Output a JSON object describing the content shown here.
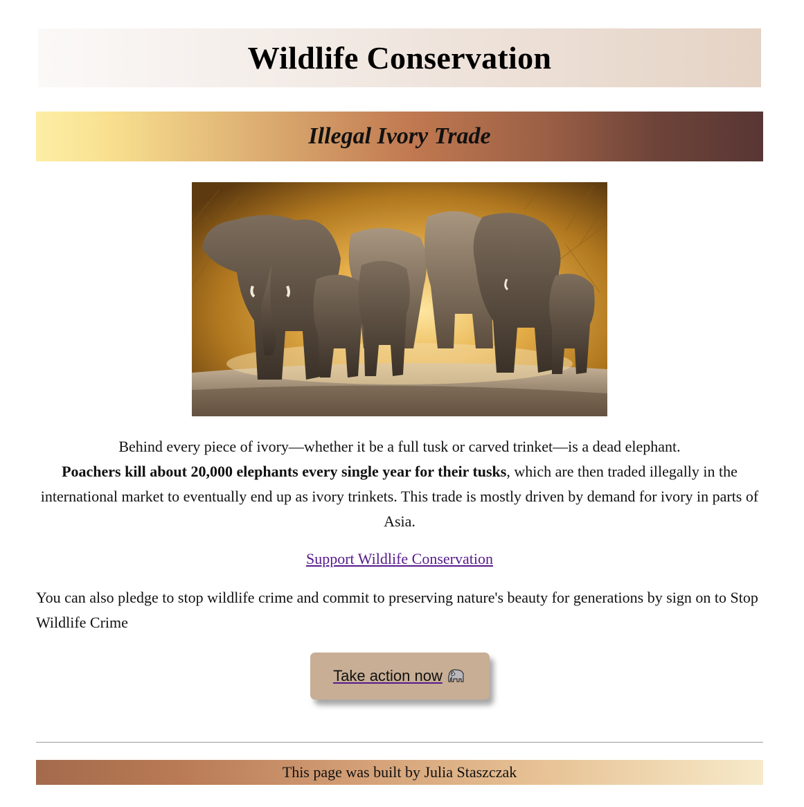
{
  "header": {
    "title": "Wildlife Conservation"
  },
  "section": {
    "title": "Illegal Ivory Trade"
  },
  "image": {
    "alt": "Herd of elephants walking through dust"
  },
  "intro": {
    "text_1": "Behind every piece of ivory—whether it be a full tusk or carved trinket—is a dead elephant.",
    "bold": "Poachers kill about 20,000 elephants every single year for their tusks",
    "text_2": ", which are then traded illegally in the international market to eventually end up as ivory trinkets. This trade is mostly driven by demand for ivory in parts of Asia."
  },
  "links": {
    "support": "Support Wildlife Conservation"
  },
  "pledge": {
    "text": "You can also pledge to stop wildlife crime and commit to preserving nature's beauty for generations by sign on to Stop Wildlife Crime"
  },
  "action": {
    "label": "Take action now",
    "icon": "elephant-icon"
  },
  "footer": {
    "text": "This page was built by Julia Staszczak"
  },
  "colors": {
    "link": "#551a8b",
    "button": "#c8ae95"
  }
}
